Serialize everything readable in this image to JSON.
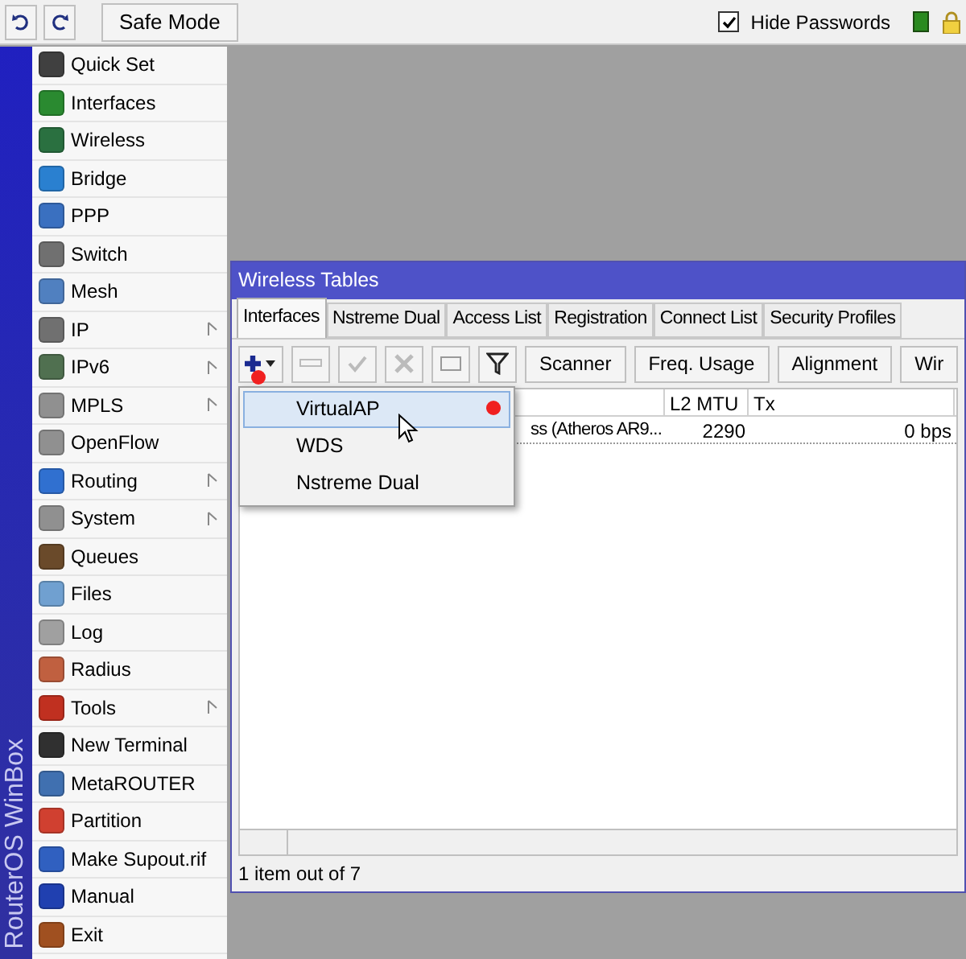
{
  "toolbar": {
    "safe_mode": "Safe Mode",
    "hide_passwords": {
      "label": "Hide Passwords",
      "checked": true
    }
  },
  "side_label": "RouterOS WinBox",
  "menu": [
    {
      "label": "Quick Set",
      "submenu": false
    },
    {
      "label": "Interfaces",
      "submenu": false
    },
    {
      "label": "Wireless",
      "submenu": false
    },
    {
      "label": "Bridge",
      "submenu": false
    },
    {
      "label": "PPP",
      "submenu": false
    },
    {
      "label": "Switch",
      "submenu": false
    },
    {
      "label": "Mesh",
      "submenu": false
    },
    {
      "label": "IP",
      "submenu": true
    },
    {
      "label": "IPv6",
      "submenu": true
    },
    {
      "label": "MPLS",
      "submenu": true
    },
    {
      "label": "OpenFlow",
      "submenu": false
    },
    {
      "label": "Routing",
      "submenu": true
    },
    {
      "label": "System",
      "submenu": true
    },
    {
      "label": "Queues",
      "submenu": false
    },
    {
      "label": "Files",
      "submenu": false
    },
    {
      "label": "Log",
      "submenu": false
    },
    {
      "label": "Radius",
      "submenu": false
    },
    {
      "label": "Tools",
      "submenu": true
    },
    {
      "label": "New Terminal",
      "submenu": false
    },
    {
      "label": "MetaROUTER",
      "submenu": false
    },
    {
      "label": "Partition",
      "submenu": false
    },
    {
      "label": "Make Supout.rif",
      "submenu": false
    },
    {
      "label": "Manual",
      "submenu": false
    },
    {
      "label": "Exit",
      "submenu": false
    }
  ],
  "window": {
    "title": "Wireless Tables",
    "tabs": [
      {
        "label": "Interfaces",
        "selected": true
      },
      {
        "label": "Nstreme Dual",
        "selected": false
      },
      {
        "label": "Access List",
        "selected": false
      },
      {
        "label": "Registration",
        "selected": false
      },
      {
        "label": "Connect List",
        "selected": false
      },
      {
        "label": "Security Profiles",
        "selected": false
      }
    ],
    "buttons": [
      "Scanner",
      "Freq. Usage",
      "Alignment",
      "Wir"
    ],
    "table": {
      "columns": [
        "",
        "L2 MTU",
        "Tx"
      ],
      "rows": [
        [
          "ss (Atheros AR9...",
          "2290",
          "0 bps"
        ]
      ]
    },
    "dropdown": [
      {
        "label": "VirtualAP",
        "selected": true
      },
      {
        "label": "WDS",
        "selected": false
      },
      {
        "label": "Nstreme Dual",
        "selected": false
      }
    ],
    "status": "1 item out of 7"
  }
}
